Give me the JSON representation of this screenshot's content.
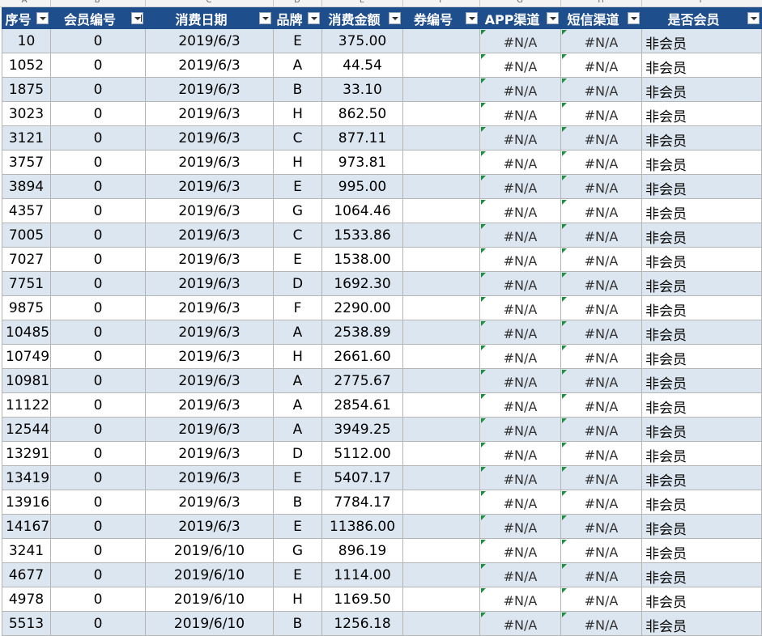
{
  "column_letters": [
    "A",
    "B",
    "C",
    "D",
    "E",
    "F",
    "G",
    "H",
    "I"
  ],
  "headers": [
    {
      "label": "序号"
    },
    {
      "label": "会员编号"
    },
    {
      "label": "消费日期"
    },
    {
      "label": "品牌"
    },
    {
      "label": "消费金额"
    },
    {
      "label": "券编号"
    },
    {
      "label": "APP渠道"
    },
    {
      "label": "短信渠道"
    },
    {
      "label": "是否会员"
    }
  ],
  "rows": [
    [
      "10",
      "0",
      "2019/6/3",
      "E",
      "375.00",
      "",
      "#N/A",
      "#N/A",
      "非会员"
    ],
    [
      "1052",
      "0",
      "2019/6/3",
      "A",
      "44.54",
      "",
      "#N/A",
      "#N/A",
      "非会员"
    ],
    [
      "1875",
      "0",
      "2019/6/3",
      "B",
      "33.10",
      "",
      "#N/A",
      "#N/A",
      "非会员"
    ],
    [
      "3023",
      "0",
      "2019/6/3",
      "H",
      "862.50",
      "",
      "#N/A",
      "#N/A",
      "非会员"
    ],
    [
      "3121",
      "0",
      "2019/6/3",
      "C",
      "877.11",
      "",
      "#N/A",
      "#N/A",
      "非会员"
    ],
    [
      "3757",
      "0",
      "2019/6/3",
      "H",
      "973.81",
      "",
      "#N/A",
      "#N/A",
      "非会员"
    ],
    [
      "3894",
      "0",
      "2019/6/3",
      "E",
      "995.00",
      "",
      "#N/A",
      "#N/A",
      "非会员"
    ],
    [
      "4357",
      "0",
      "2019/6/3",
      "G",
      "1064.46",
      "",
      "#N/A",
      "#N/A",
      "非会员"
    ],
    [
      "7005",
      "0",
      "2019/6/3",
      "C",
      "1533.86",
      "",
      "#N/A",
      "#N/A",
      "非会员"
    ],
    [
      "7027",
      "0",
      "2019/6/3",
      "E",
      "1538.00",
      "",
      "#N/A",
      "#N/A",
      "非会员"
    ],
    [
      "7751",
      "0",
      "2019/6/3",
      "D",
      "1692.30",
      "",
      "#N/A",
      "#N/A",
      "非会员"
    ],
    [
      "9875",
      "0",
      "2019/6/3",
      "F",
      "2290.00",
      "",
      "#N/A",
      "#N/A",
      "非会员"
    ],
    [
      "10485",
      "0",
      "2019/6/3",
      "A",
      "2538.89",
      "",
      "#N/A",
      "#N/A",
      "非会员"
    ],
    [
      "10749",
      "0",
      "2019/6/3",
      "H",
      "2661.60",
      "",
      "#N/A",
      "#N/A",
      "非会员"
    ],
    [
      "10981",
      "0",
      "2019/6/3",
      "A",
      "2775.67",
      "",
      "#N/A",
      "#N/A",
      "非会员"
    ],
    [
      "11122",
      "0",
      "2019/6/3",
      "A",
      "2854.61",
      "",
      "#N/A",
      "#N/A",
      "非会员"
    ],
    [
      "12544",
      "0",
      "2019/6/3",
      "A",
      "3949.25",
      "",
      "#N/A",
      "#N/A",
      "非会员"
    ],
    [
      "13291",
      "0",
      "2019/6/3",
      "D",
      "5112.00",
      "",
      "#N/A",
      "#N/A",
      "非会员"
    ],
    [
      "13419",
      "0",
      "2019/6/3",
      "E",
      "5407.17",
      "",
      "#N/A",
      "#N/A",
      "非会员"
    ],
    [
      "13916",
      "0",
      "2019/6/3",
      "B",
      "7784.17",
      "",
      "#N/A",
      "#N/A",
      "非会员"
    ],
    [
      "14167",
      "0",
      "2019/6/3",
      "E",
      "11386.00",
      "",
      "#N/A",
      "#N/A",
      "非会员"
    ],
    [
      "3241",
      "0",
      "2019/6/10",
      "G",
      "896.19",
      "",
      "#N/A",
      "#N/A",
      "非会员"
    ],
    [
      "4677",
      "0",
      "2019/6/10",
      "E",
      "1114.00",
      "",
      "#N/A",
      "#N/A",
      "非会员"
    ],
    [
      "4978",
      "0",
      "2019/6/10",
      "H",
      "1169.50",
      "",
      "#N/A",
      "#N/A",
      "非会员"
    ],
    [
      "5513",
      "0",
      "2019/6/10",
      "B",
      "1256.18",
      "",
      "#N/A",
      "#N/A",
      "非会员"
    ]
  ],
  "colors": {
    "header_bg": "#1f4e8c",
    "band_bg": "#dce6f1",
    "error_marker": "#1e8f3e"
  }
}
